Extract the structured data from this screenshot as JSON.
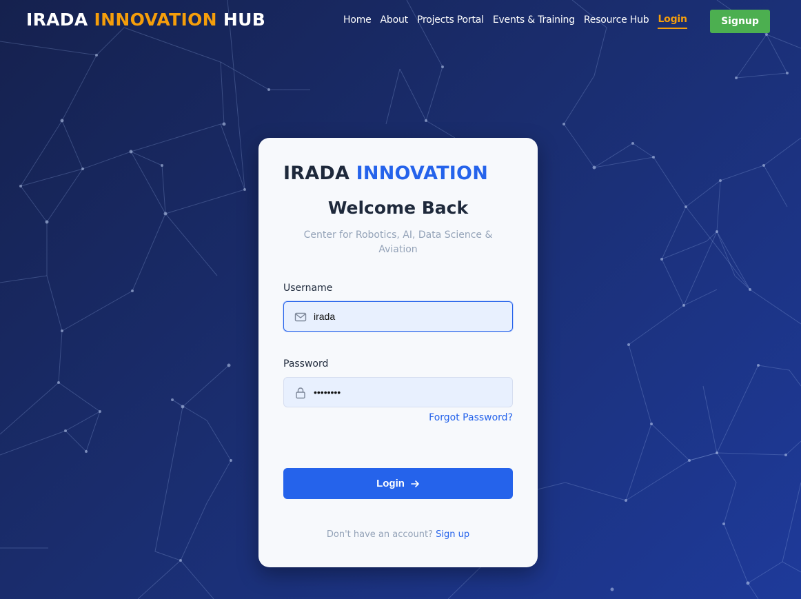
{
  "header": {
    "brand_part1": "IRADA",
    "brand_part2": "INNOVATION",
    "brand_part3": "HUB",
    "nav": {
      "home": "Home",
      "about": "About",
      "projects": "Projects Portal",
      "events": "Events & Training",
      "resources": "Resource Hub",
      "login": "Login"
    },
    "signup_label": "Signup"
  },
  "card": {
    "brand_part1": "IRADA",
    "brand_part2": "INNOVATION",
    "title": "Welcome Back",
    "subtitle": "Center for Robotics, AI, Data Science & Aviation",
    "username_label": "Username",
    "username_value": "irada",
    "password_label": "Password",
    "password_value": "irada123",
    "forgot_label": "Forgot Password?",
    "login_label": "Login",
    "footer_prompt": "Don't have an account?",
    "footer_link": "Sign up"
  },
  "colors": {
    "accent_orange": "#f59e0b",
    "primary_blue": "#2563eb",
    "signup_green": "#4caf50",
    "background": "#1a2d6e"
  },
  "icons": {
    "username": "mail-icon",
    "password": "lock-icon",
    "login": "arrow-right-icon"
  }
}
